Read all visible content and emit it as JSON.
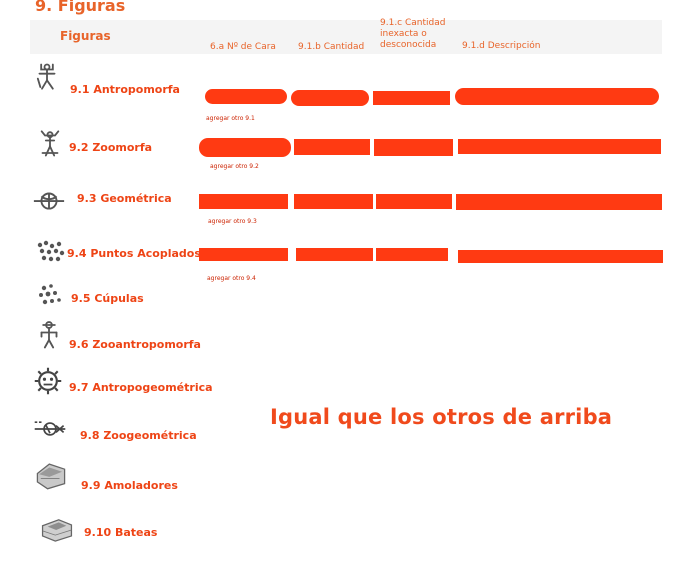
{
  "page_title": "9. Figuras",
  "table": {
    "header_label": "Figuras",
    "columns": [
      "6.a Nº de Cara",
      "9.1.b Cantidad",
      "9.1.c Cantidad inexacta o desconocida",
      "9.1.d Descripción"
    ]
  },
  "rows": [
    {
      "label": "9.1 Antropomorfa",
      "icon": "anthropomorphic-petroglyph-icon",
      "add_link": "agregar otro 9.1"
    },
    {
      "label": "9.2 Zoomorfa",
      "icon": "zoomorphic-petroglyph-icon",
      "add_link": "agregar otro 9.2"
    },
    {
      "label": "9.3  Geométrica",
      "icon": "geometric-petroglyph-icon",
      "add_link": "agregar otro 9.3"
    },
    {
      "label": "9.4 Puntos Acoplados",
      "icon": "coupled-points-icon",
      "add_link": "agregar otro 9.4"
    },
    {
      "label": "9.5 Cúpulas",
      "icon": "cupules-icon"
    },
    {
      "label": "9.6 Zooantropomorfa",
      "icon": "zooanthropomorphic-petroglyph-icon"
    },
    {
      "label": "9.7 Antropogeométrica",
      "icon": "anthropogeometric-petroglyph-icon"
    },
    {
      "label": "9.8 Zoogeométrica",
      "icon": "zoogeometric-petroglyph-icon"
    },
    {
      "label": "9.9 Amoladores",
      "icon": "grinder-stone-icon"
    },
    {
      "label": "9.10 Bateas",
      "icon": "batea-stone-icon"
    }
  ],
  "note": "Igual que los otros de arriba",
  "colors": {
    "accent": "#e8642a",
    "field": "#ff3a12",
    "header_bg": "#f4f4f4"
  }
}
